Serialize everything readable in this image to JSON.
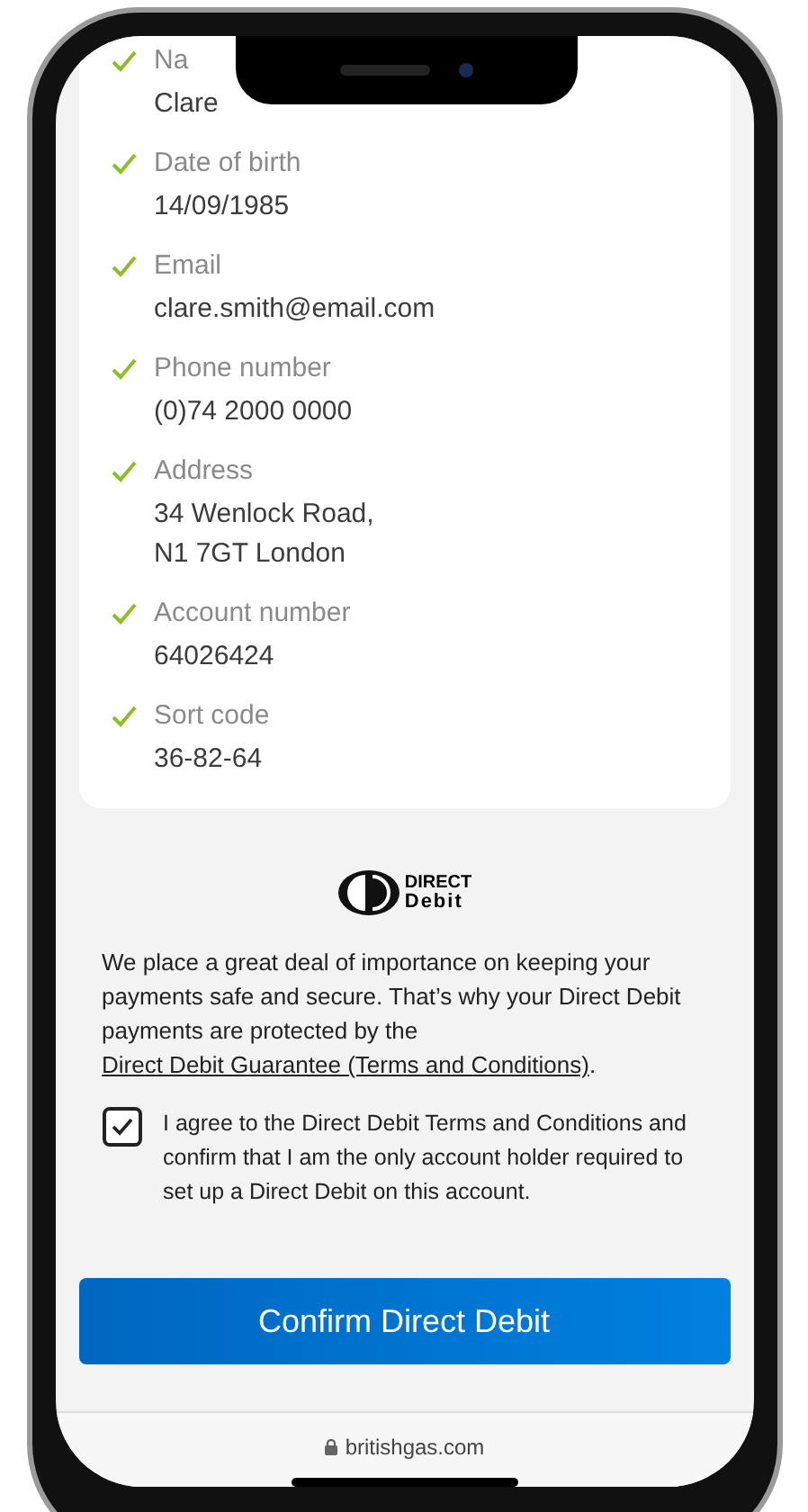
{
  "details": [
    {
      "label": "Na",
      "value_lines": [
        "Clare"
      ]
    },
    {
      "label": "Date of birth",
      "value_lines": [
        "14/09/1985"
      ]
    },
    {
      "label": "Email",
      "value_lines": [
        "clare.smith@email.com"
      ]
    },
    {
      "label": "Phone number",
      "value_lines": [
        "(0)74 2000 0000"
      ]
    },
    {
      "label": "Address",
      "value_lines": [
        "34 Wenlock Road,",
        "N1 7GT London"
      ]
    },
    {
      "label": "Account number",
      "value_lines": [
        "64026424"
      ]
    },
    {
      "label": "Sort code",
      "value_lines": [
        "36-82-64"
      ]
    }
  ],
  "logo": {
    "line_1": "DIRECT",
    "line_2": "Debit"
  },
  "notice": {
    "text": "We place a great deal of importance on keeping your payments safe and secure. That’s why your Direct Debit payments are protected by the",
    "link": "Direct Debit Guarantee (Terms and Conditions)",
    "end": "."
  },
  "agreement": {
    "checked": true,
    "text": "I agree to the Direct Debit Terms and Conditions and confirm that I am the only account holder required to set up a Direct Debit on this account."
  },
  "confirm_button": "Confirm Direct Debit",
  "address_bar": {
    "url": "britishgas.com"
  }
}
